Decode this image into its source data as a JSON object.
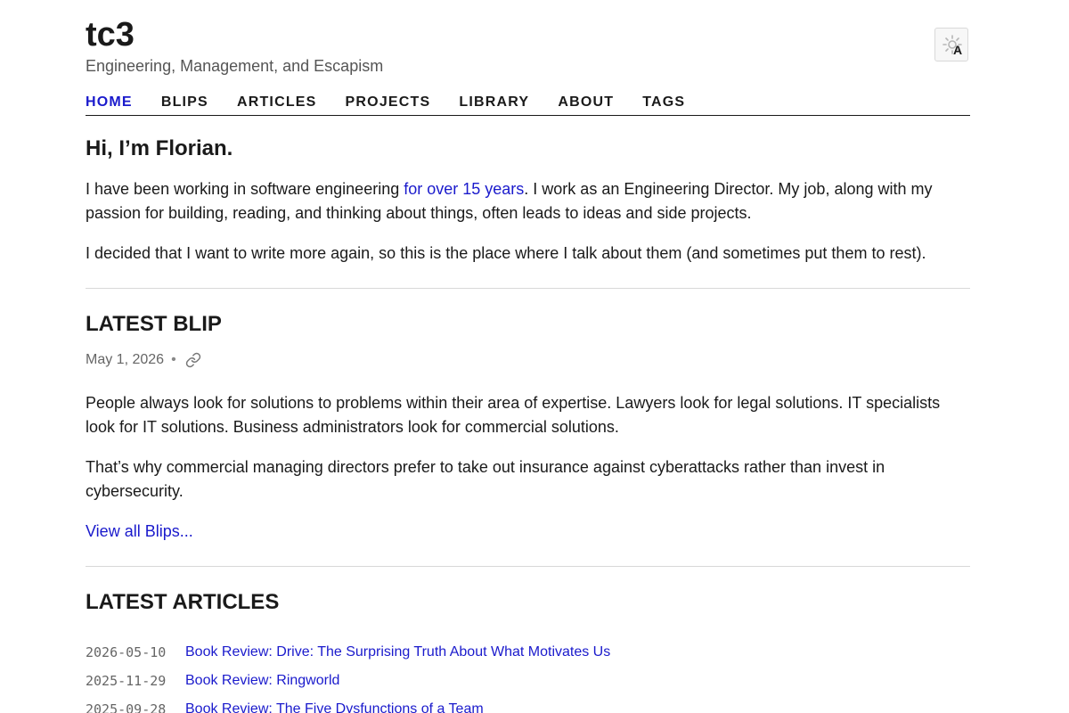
{
  "header": {
    "site_title": "tc3",
    "subtitle": "Engineering, Management, and Escapism",
    "theme_toggle_letter": "A"
  },
  "nav": {
    "items": [
      {
        "label": "HOME",
        "active": true
      },
      {
        "label": "BLIPS",
        "active": false
      },
      {
        "label": "ARTICLES",
        "active": false
      },
      {
        "label": "PROJECTS",
        "active": false
      },
      {
        "label": "LIBRARY",
        "active": false
      },
      {
        "label": "ABOUT",
        "active": false
      },
      {
        "label": "TAGS",
        "active": false
      }
    ]
  },
  "intro": {
    "greeting": "Hi, I’m Florian.",
    "p1_before": "I have been working in software engineering ",
    "p1_link": "for over 15 years",
    "p1_after": ". I work as an Engineering Director. My job, along with my passion for building, reading, and thinking about things, often leads to ideas and side projects.",
    "p2": "I decided that I want to write more again, so this is the place where I talk about them (and sometimes put them to rest)."
  },
  "latest_blip": {
    "heading": "LATEST BLIP",
    "date": "May 1, 2026",
    "separator": "•",
    "p1": "People always look for solutions to problems within their area of expertise. Lawyers look for legal solutions. IT specialists look for IT solutions. Business administrators look for commercial solutions.",
    "p2": "That’s why commercial managing directors prefer to take out insurance against cyberattacks rather than invest in cybersecurity.",
    "view_all": "View all Blips..."
  },
  "latest_articles": {
    "heading": "LATEST ARTICLES",
    "items": [
      {
        "date": "2026-05-10",
        "title": "Book Review: Drive: The Surprising Truth About What Motivates Us"
      },
      {
        "date": "2025-11-29",
        "title": "Book Review: Ringworld"
      },
      {
        "date": "2025-09-28",
        "title": "Book Review: The Five Dysfunctions of a Team"
      }
    ]
  },
  "colors": {
    "accent_link": "#1a1acc",
    "text": "#1a1a1a",
    "muted": "#666666"
  }
}
